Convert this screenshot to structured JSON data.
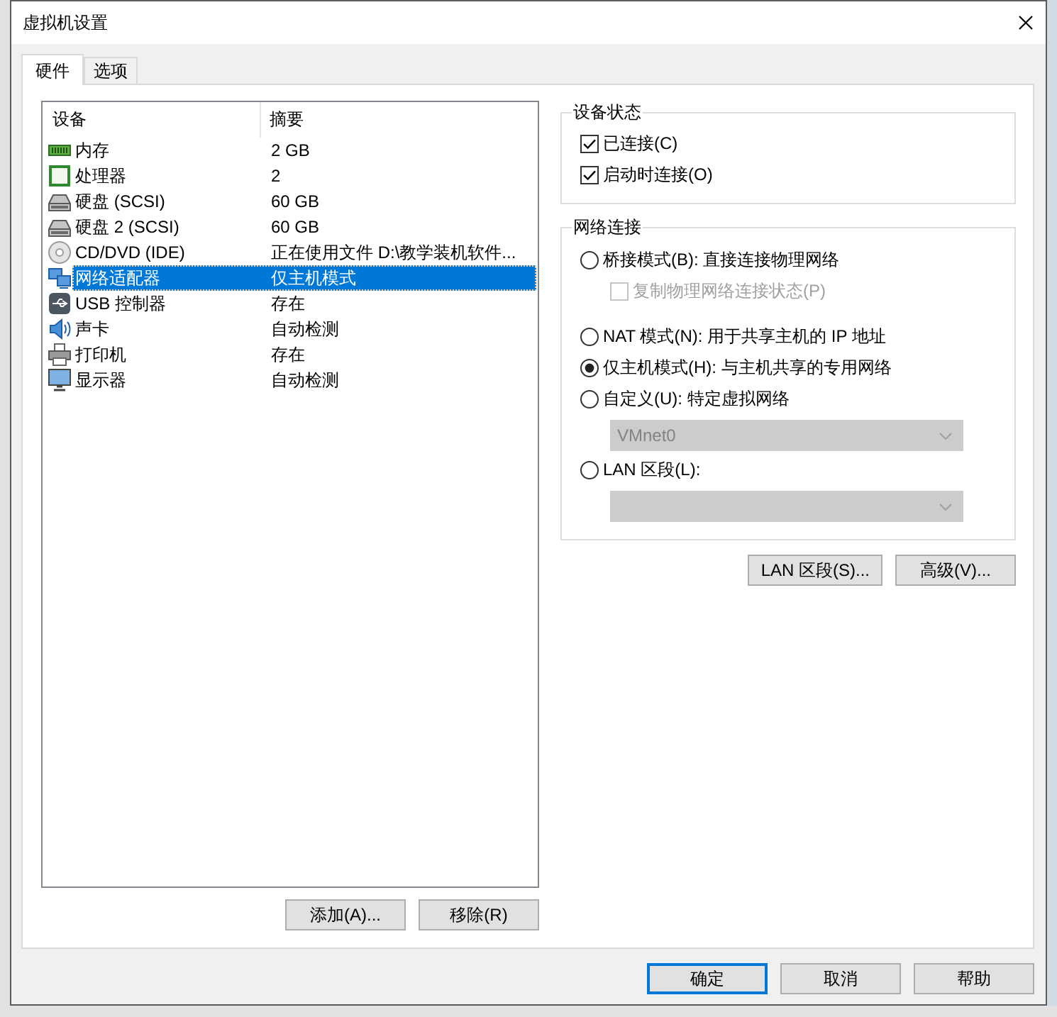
{
  "window": {
    "title": "虚拟机设置"
  },
  "tabs": [
    {
      "label": "硬件",
      "selected": true
    },
    {
      "label": "选项",
      "selected": false
    }
  ],
  "device_list": {
    "columns": [
      "设备",
      "摘要"
    ],
    "rows": [
      {
        "kind": "memory",
        "device": "内存",
        "summary": "2 GB",
        "selected": false
      },
      {
        "kind": "processor",
        "device": "处理器",
        "summary": "2",
        "selected": false
      },
      {
        "kind": "disk",
        "device": "硬盘 (SCSI)",
        "summary": "60 GB",
        "selected": false
      },
      {
        "kind": "disk",
        "device": "硬盘 2 (SCSI)",
        "summary": "60 GB",
        "selected": false
      },
      {
        "kind": "cd",
        "device": "CD/DVD (IDE)",
        "summary": "正在使用文件 D:\\教学装机软件...",
        "selected": false
      },
      {
        "kind": "network",
        "device": "网络适配器",
        "summary": "仅主机模式",
        "selected": true
      },
      {
        "kind": "usb",
        "device": "USB 控制器",
        "summary": "存在",
        "selected": false
      },
      {
        "kind": "sound",
        "device": "声卡",
        "summary": "自动检测",
        "selected": false
      },
      {
        "kind": "printer",
        "device": "打印机",
        "summary": "存在",
        "selected": false
      },
      {
        "kind": "display",
        "device": "显示器",
        "summary": "自动检测",
        "selected": false
      }
    ]
  },
  "list_buttons": {
    "add": "添加(A)...",
    "remove": "移除(R)"
  },
  "device_status": {
    "title": "设备状态",
    "options": [
      {
        "label": "已连接(C)",
        "checked": true
      },
      {
        "label": "启动时连接(O)",
        "checked": true
      }
    ]
  },
  "network_connection": {
    "title": "网络连接",
    "options": [
      {
        "kind": "radio",
        "label": "桥接模式(B): 直接连接物理网络",
        "selected": false,
        "disabled": false,
        "children": [
          {
            "kind": "checkbox",
            "label": "复制物理网络连接状态(P)",
            "checked": false,
            "disabled": true
          }
        ]
      },
      {
        "kind": "radio",
        "label": "NAT 模式(N): 用于共享主机的 IP 地址",
        "selected": false,
        "disabled": false
      },
      {
        "kind": "radio",
        "label": "仅主机模式(H): 与主机共享的专用网络",
        "selected": true,
        "disabled": false
      },
      {
        "kind": "radio",
        "label": "自定义(U): 特定虚拟网络",
        "selected": false,
        "disabled": false,
        "children": [
          {
            "kind": "dropdown",
            "value": "VMnet0",
            "disabled": true
          }
        ]
      },
      {
        "kind": "radio",
        "label": "LAN 区段(L):",
        "selected": false,
        "disabled": false,
        "children": [
          {
            "kind": "dropdown",
            "disabled": true
          }
        ]
      }
    ]
  },
  "network_buttons": {
    "lan_segments": "LAN 区段(S)...",
    "advanced": "高级(V)..."
  },
  "dialog_buttons": {
    "ok": {
      "label": "确定",
      "focused": true
    },
    "cancel": {
      "label": "取消",
      "focused": false
    },
    "help": {
      "label": "帮助",
      "focused": false
    }
  }
}
